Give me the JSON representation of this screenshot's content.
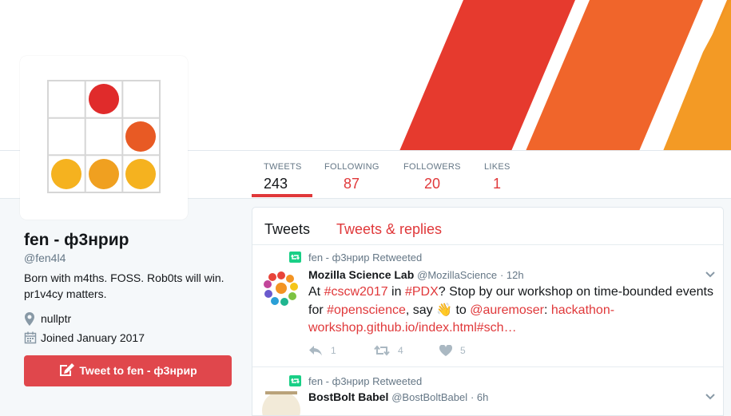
{
  "colors": {
    "accent": "#e0383a",
    "button_bg": "#e0474c",
    "muted": "#657786"
  },
  "stats": [
    {
      "label": "TWEETS",
      "value": "243"
    },
    {
      "label": "FOLLOWING",
      "value": "87"
    },
    {
      "label": "FOLLOWERS",
      "value": "20"
    },
    {
      "label": "LIKES",
      "value": "1"
    }
  ],
  "profile": {
    "name": "fen - ф3нрир",
    "handle": "@fen4l4",
    "bio_line1": "Born with m4ths. FOSS. Rob0ts will win.",
    "bio_line2": "pr1v4cy matters.",
    "location": "nullptr",
    "joined": "Joined January 2017",
    "tweet_to_label": "Tweet to fen - ф3нрир"
  },
  "timeline": {
    "tabs": [
      "Tweets",
      "Tweets & replies"
    ],
    "tweets": [
      {
        "retweet_context": "fen - ф3нрир Retweeted",
        "name": "Mozilla Science Lab",
        "handle": "@MozillaScience",
        "time": "· 12h",
        "text": {
          "p1": "At ",
          "h1": "#cscw2017",
          "p2": " in ",
          "h2": "#PDX",
          "p3": "? Stop by our workshop on time-bounded events for ",
          "h3": "#openscience",
          "p4": ", say ",
          "emoji": "👋",
          "p5": " to ",
          "mention": "@auremoser",
          "p6": ": ",
          "url": "hackathon-workshop.github.io/index.html#sch…"
        },
        "replies": "1",
        "retweets": "4",
        "likes": "5"
      },
      {
        "retweet_context": "fen - ф3нрир Retweeted",
        "name": "BostBolt Babel",
        "handle": "@BostBoltBabel",
        "time": "· 6h"
      }
    ]
  },
  "icons": [
    "retweet-icon",
    "reply-icon",
    "like-icon",
    "location-icon",
    "calendar-icon",
    "compose-icon",
    "chevron-down-icon"
  ]
}
